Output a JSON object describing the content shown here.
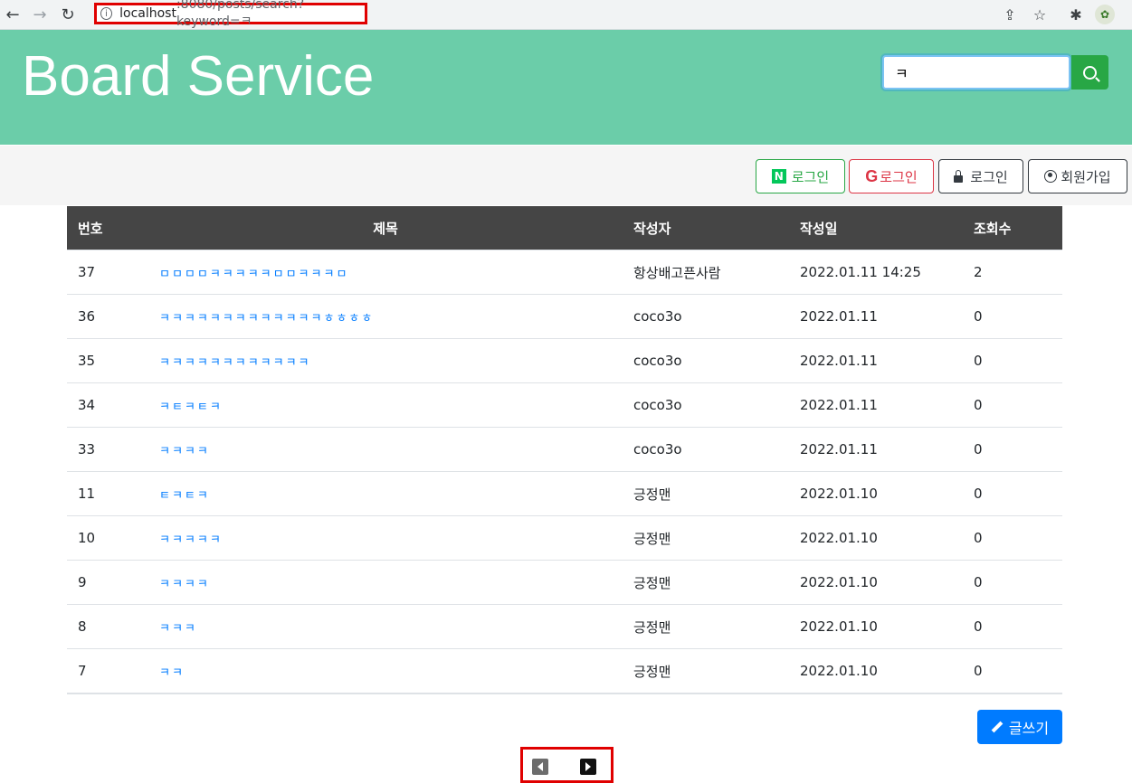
{
  "browser": {
    "url_host": "localhost",
    "url_rest": ":8080/posts/search?keyword=ㅋ"
  },
  "header": {
    "brand": "Board Service",
    "search_value": "ㅋ"
  },
  "auth": {
    "naver_label": "로그인",
    "google_label": "로그인",
    "local_label": "로그인",
    "signup_label": "회원가입"
  },
  "table": {
    "headers": [
      "번호",
      "제목",
      "작성자",
      "작성일",
      "조회수"
    ],
    "rows": [
      {
        "no": "37",
        "title": "ㅁㅁㅁㅁㅋㅋㅋㅋㅋㅁㅁㅋㅋㅋㅁ",
        "author": "항상배고픈사람",
        "date": "2022.01.11 14:25",
        "views": "2"
      },
      {
        "no": "36",
        "title": "ㅋㅋㅋㅋㅋㅋㅋㅋㅋㅋㅋㅋㅋㅎㅎㅎㅎ",
        "author": "coco3o",
        "date": "2022.01.11",
        "views": "0"
      },
      {
        "no": "35",
        "title": "ㅋㅋㅋㅋㅋㅋㅋㅋㅋㅋㅋㅋ",
        "author": "coco3o",
        "date": "2022.01.11",
        "views": "0"
      },
      {
        "no": "34",
        "title": "ㅋㅌㅋㅌㅋ",
        "author": "coco3o",
        "date": "2022.01.11",
        "views": "0"
      },
      {
        "no": "33",
        "title": "ㅋㅋㅋㅋ",
        "author": "coco3o",
        "date": "2022.01.11",
        "views": "0"
      },
      {
        "no": "11",
        "title": "ㅌㅋㅌㅋ",
        "author": "긍정맨",
        "date": "2022.01.10",
        "views": "0"
      },
      {
        "no": "10",
        "title": "ㅋㅋㅋㅋㅋ",
        "author": "긍정맨",
        "date": "2022.01.10",
        "views": "0"
      },
      {
        "no": "9",
        "title": "ㅋㅋㅋㅋ",
        "author": "긍정맨",
        "date": "2022.01.10",
        "views": "0"
      },
      {
        "no": "8",
        "title": "ㅋㅋㅋ",
        "author": "긍정맨",
        "date": "2022.01.10",
        "views": "0"
      },
      {
        "no": "7",
        "title": "ㅋㅋ",
        "author": "긍정맨",
        "date": "2022.01.10",
        "views": "0"
      }
    ]
  },
  "write_label": "글쓰기",
  "colors": {
    "header_bg": "#6bcda9",
    "primary": "#007bff",
    "success": "#28a745",
    "danger": "#dc3545",
    "table_head": "#454545"
  }
}
